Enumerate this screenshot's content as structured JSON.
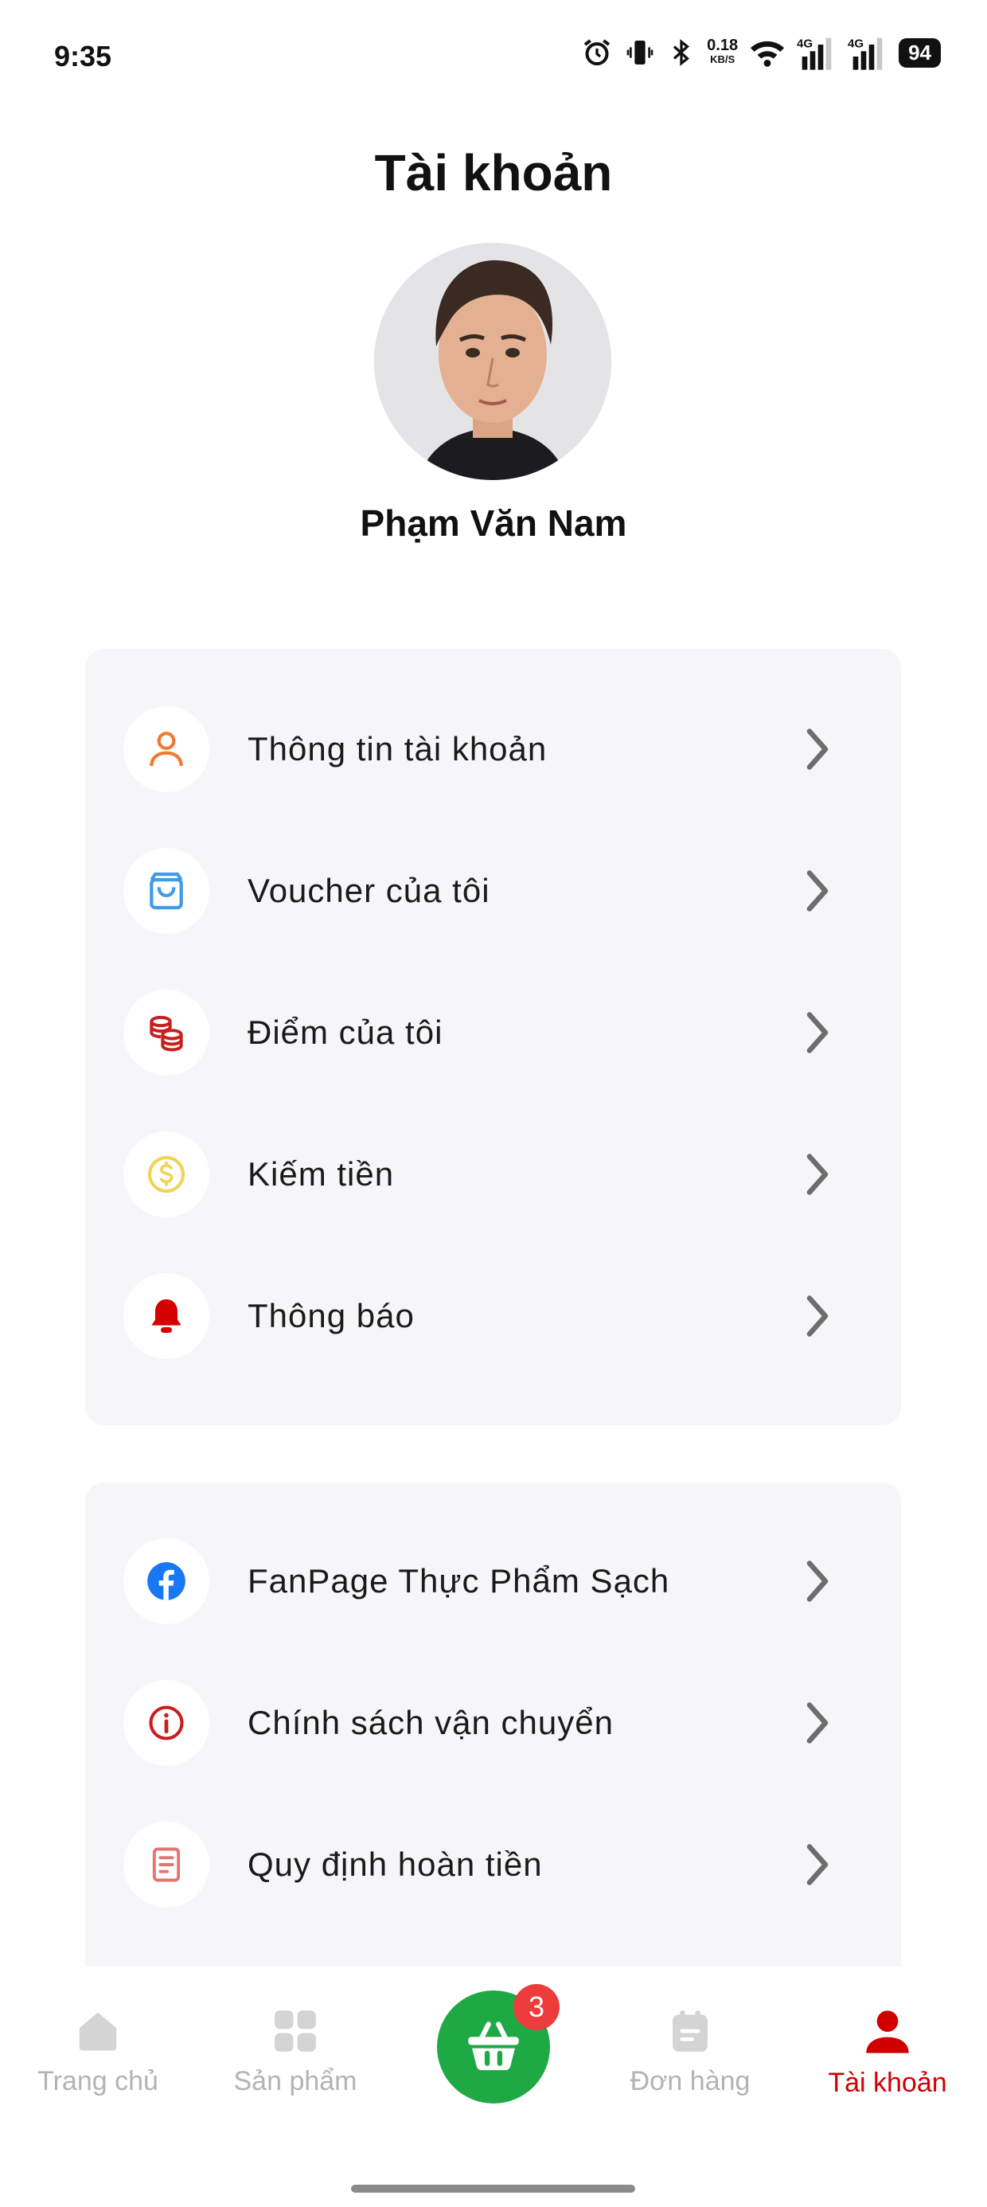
{
  "status_bar": {
    "time": "9:35",
    "net_speed_value": "0.18",
    "net_speed_unit": "KB/S",
    "signal_1": "4G",
    "signal_2": "4G",
    "battery": "94"
  },
  "header": {
    "title": "Tài khoản"
  },
  "profile": {
    "name": "Phạm Văn Nam"
  },
  "menu_primary": [
    {
      "label": "Thông tin tài khoản",
      "icon": "person-icon",
      "color": "#f07a35"
    },
    {
      "label": "Voucher của tôi",
      "icon": "shopping-bag-icon",
      "color": "#3d9be9"
    },
    {
      "label": "Điểm của tôi",
      "icon": "coins-icon",
      "color": "#c81e1e"
    },
    {
      "label": "Kiếm tiền",
      "icon": "dollar-coin-icon",
      "color": "#f2d35a"
    },
    {
      "label": "Thông báo",
      "icon": "bell-icon",
      "color": "#d60000"
    }
  ],
  "menu_secondary": [
    {
      "label": "FanPage Thực Phẩm Sạch",
      "icon": "facebook-icon",
      "color": "#1877f2"
    },
    {
      "label": "Chính sách vận chuyển",
      "icon": "info-icon",
      "color": "#c81e1e"
    },
    {
      "label": "Quy định hoàn tiền",
      "icon": "document-icon",
      "color": "#e57373"
    }
  ],
  "bottom_nav": {
    "home": "Trang chủ",
    "products": "Sản phẩm",
    "cart_count": "3",
    "orders": "Đơn hàng",
    "account": "Tài khoản",
    "active": "account",
    "active_color": "#d10000",
    "cart_color": "#1fa945"
  }
}
